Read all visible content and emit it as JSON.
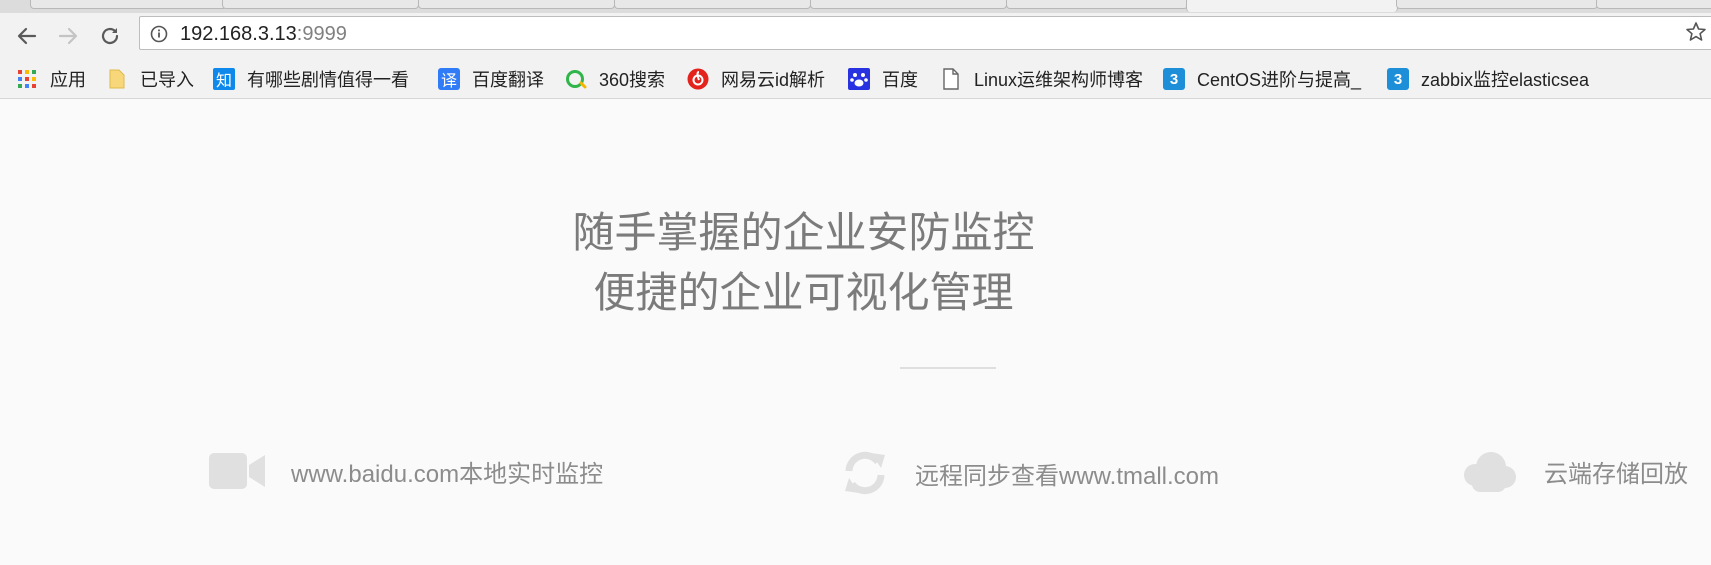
{
  "browser": {
    "url_host": "192.168.3.13",
    "url_port": ":9999",
    "bookmarks": [
      {
        "label": "应用",
        "icon": "apps-grid-icon"
      },
      {
        "label": "已导入",
        "icon": "folder-icon"
      },
      {
        "label": "有哪些剧情值得一看",
        "icon": "zhihu-icon",
        "badge": "知"
      },
      {
        "label": "百度翻译",
        "icon": "baidu-translate-icon",
        "badge": "译"
      },
      {
        "label": "360搜索",
        "icon": "360-search-icon"
      },
      {
        "label": "网易云id解析",
        "icon": "netease-music-icon"
      },
      {
        "label": "百度",
        "icon": "baidu-paw-icon"
      },
      {
        "label": "Linux运维架构师博客",
        "icon": "page-icon"
      },
      {
        "label": "CentOS进阶与提高_",
        "icon": "blog-3-icon",
        "badge": "3"
      },
      {
        "label": "zabbix监控elasticsea",
        "icon": "blog-3-icon",
        "badge": "3"
      }
    ]
  },
  "hero": {
    "line1": "随手掌握的企业安防监控",
    "line2": "便捷的企业可视化管理"
  },
  "features": [
    {
      "icon": "video-camera-icon",
      "text": "www.baidu.com本地实时监控"
    },
    {
      "icon": "sync-icon",
      "text": "远程同步查看www.tmall.com"
    },
    {
      "icon": "cloud-icon",
      "text": "云端存储回放"
    }
  ],
  "colors": {
    "page_bg": "#fafafa",
    "headline": "#7b7b7b",
    "feature_icon": "#e0e0e0",
    "feature_text": "#8c8c8c"
  }
}
